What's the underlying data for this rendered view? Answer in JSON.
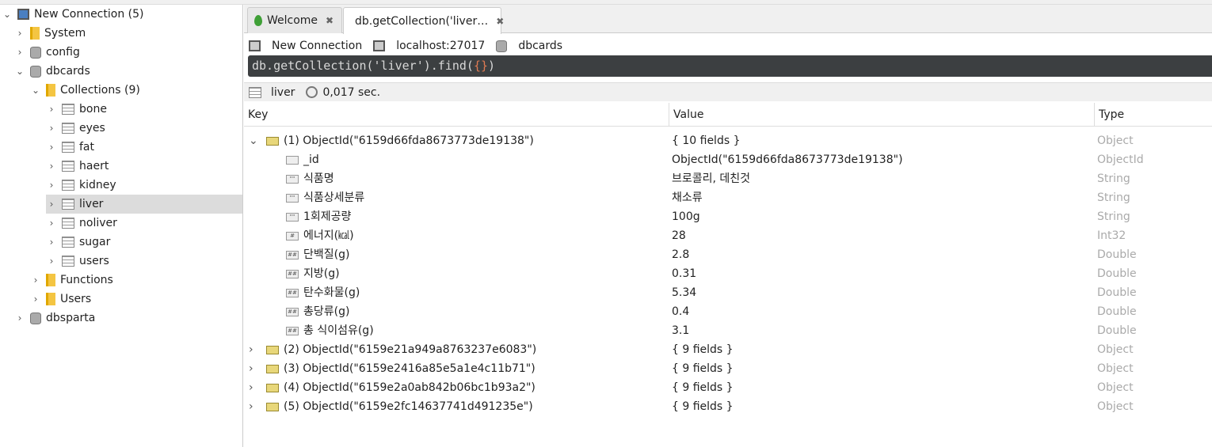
{
  "sidebar": {
    "connection": "New Connection (5)",
    "nodes": [
      {
        "label": "System",
        "type": "folder"
      },
      {
        "label": "config",
        "type": "db"
      },
      {
        "label": "dbcards",
        "type": "db"
      },
      {
        "label": "Collections (9)",
        "type": "folder"
      },
      {
        "label": "bone"
      },
      {
        "label": "eyes"
      },
      {
        "label": "fat"
      },
      {
        "label": "haert"
      },
      {
        "label": "kidney"
      },
      {
        "label": "liver"
      },
      {
        "label": "noliver"
      },
      {
        "label": "sugar"
      },
      {
        "label": "users"
      },
      {
        "label": "Functions"
      },
      {
        "label": "Users"
      },
      {
        "label": "dbsparta"
      }
    ]
  },
  "tabs": [
    {
      "label": "Welcome"
    },
    {
      "label": "db.getCollection('liver…"
    }
  ],
  "crumbs": {
    "connection": "New Connection",
    "host": "localhost:27017",
    "db": "dbcards"
  },
  "query": {
    "pre": "db.getCollection('liver').find(",
    "args": "{}",
    "post": ")"
  },
  "status": {
    "collection": "liver",
    "time": "0,017 sec."
  },
  "columns": {
    "key": "Key",
    "value": "Value",
    "type": "Type"
  },
  "rows": [
    {
      "key": "(1) ObjectId(\"6159d66fda8673773de19138\")",
      "value": "{ 10 fields }",
      "type": "Object",
      "level": 0,
      "expanded": true
    },
    {
      "key": "_id",
      "value": "ObjectId(\"6159d66fda8673773de19138\")",
      "type": "ObjectId",
      "level": 1
    },
    {
      "key": "식품명",
      "value": "브로콜리, 데친것",
      "type": "String",
      "level": 1
    },
    {
      "key": "식품상세분류",
      "value": "채소류",
      "type": "String",
      "level": 1
    },
    {
      "key": "1회제공량",
      "value": "100g",
      "type": "String",
      "level": 1
    },
    {
      "key": "에너지(㎉)",
      "value": "28",
      "type": "Int32",
      "level": 1
    },
    {
      "key": "단백질(g)",
      "value": "2.8",
      "type": "Double",
      "level": 1
    },
    {
      "key": "지방(g)",
      "value": "0.31",
      "type": "Double",
      "level": 1
    },
    {
      "key": "탄수화물(g)",
      "value": "5.34",
      "type": "Double",
      "level": 1
    },
    {
      "key": "총당류(g)",
      "value": "0.4",
      "type": "Double",
      "level": 1
    },
    {
      "key": "총 식이섬유(g)",
      "value": "3.1",
      "type": "Double",
      "level": 1
    },
    {
      "key": "(2) ObjectId(\"6159e21a949a8763237e6083\")",
      "value": "{ 9 fields }",
      "type": "Object",
      "level": 0
    },
    {
      "key": "(3) ObjectId(\"6159e2416a85e5a1e4c11b71\")",
      "value": "{ 9 fields }",
      "type": "Object",
      "level": 0
    },
    {
      "key": "(4) ObjectId(\"6159e2a0ab842b06bc1b93a2\")",
      "value": "{ 9 fields }",
      "type": "Object",
      "level": 0
    },
    {
      "key": "(5) ObjectId(\"6159e2fc14637741d491235e\")",
      "value": "{ 9 fields }",
      "type": "Object",
      "level": 0
    }
  ]
}
